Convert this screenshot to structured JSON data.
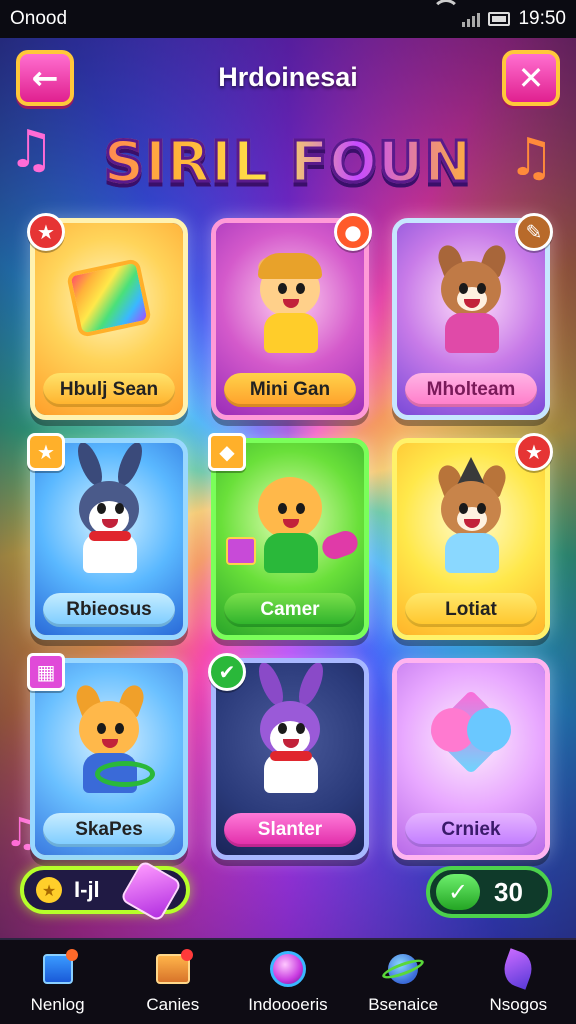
{
  "status_bar": {
    "carrier": "Onood",
    "time": "19:50"
  },
  "header": {
    "title": "Hrdoinesai",
    "back_icon": "arrow-left-icon",
    "close_icon": "close-icon"
  },
  "game_title": "SIRIL FOUN",
  "cards": [
    {
      "label": "Hbulj Sean",
      "badge": "star",
      "art": "rainbow-card"
    },
    {
      "label": "Mini Gan",
      "badge": "ball",
      "art": "boy-character"
    },
    {
      "label": "Mholteam",
      "badge": "paintbrush",
      "art": "cat-character"
    },
    {
      "label": "Rbieosus",
      "badge": "star",
      "art": "bunny-character"
    },
    {
      "label": "Camer",
      "badge": "crystal",
      "art": "baby-character"
    },
    {
      "label": "Lotiat",
      "badge": "star",
      "art": "fox-character"
    },
    {
      "label": "SkaPes",
      "badge": "gem",
      "art": "cat-character"
    },
    {
      "label": "Slanter",
      "badge": "gem",
      "art": "bunny-character"
    },
    {
      "label": "Crniek",
      "badge": "none",
      "art": "heart"
    }
  ],
  "progress": {
    "text": "I-jl"
  },
  "toggle": {
    "value": "30"
  },
  "bottom_nav": [
    {
      "label": "Nenlog",
      "icon": "blocks-icon"
    },
    {
      "label": "Canies",
      "icon": "box-icon"
    },
    {
      "label": "Indoooeris",
      "icon": "orb-icon"
    },
    {
      "label": "Bsenaice",
      "icon": "planet-icon"
    },
    {
      "label": "Nsogos",
      "icon": "leaf-icon"
    }
  ],
  "colors": {
    "accent_pink": "#e0208f",
    "accent_yellow": "#ffc83a",
    "accent_green": "#4cd24c"
  }
}
